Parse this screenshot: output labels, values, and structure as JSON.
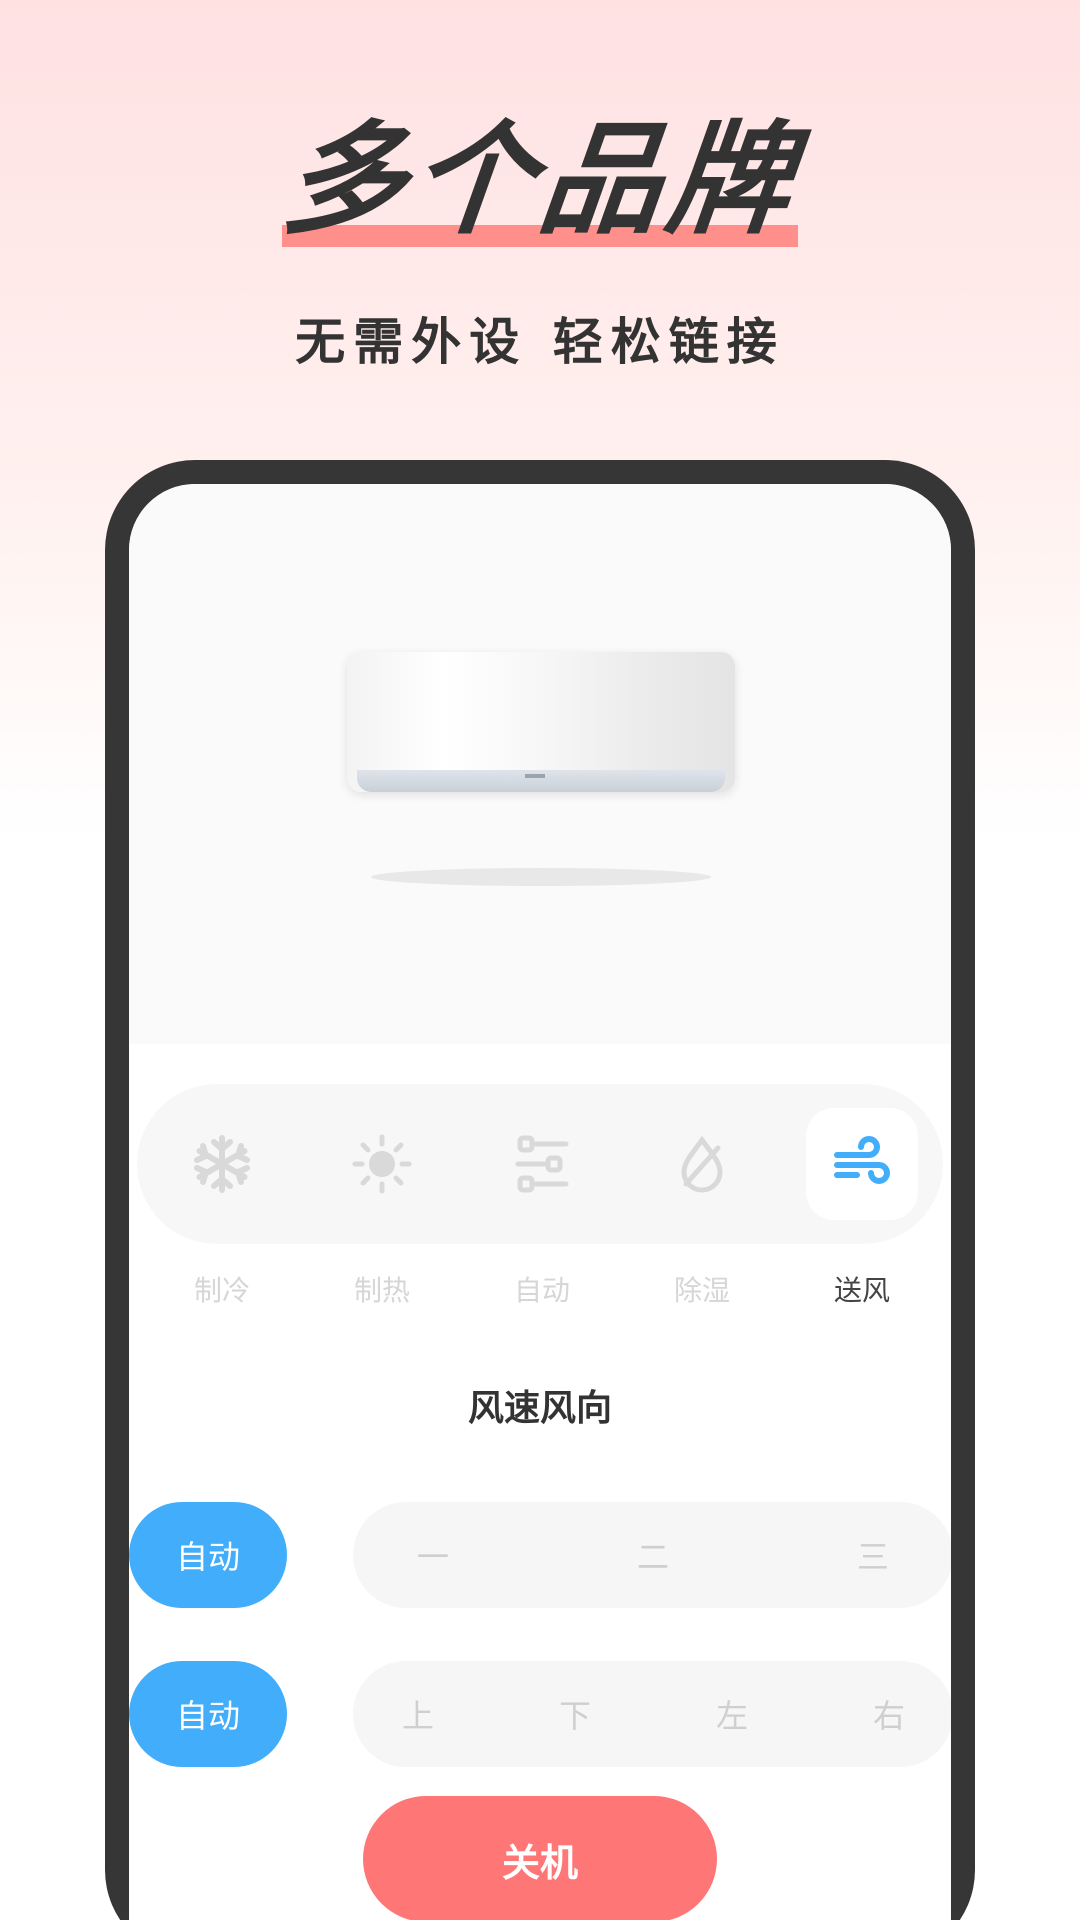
{
  "header": {
    "title": "多个品牌",
    "subtitle": "无需外设 轻松链接"
  },
  "modes": [
    {
      "label": "制冷",
      "icon": "snowflake-icon",
      "active": false
    },
    {
      "label": "制热",
      "icon": "sun-icon",
      "active": false
    },
    {
      "label": "自动",
      "icon": "sliders-icon",
      "active": false
    },
    {
      "label": "除湿",
      "icon": "droplet-slash-icon",
      "active": false
    },
    {
      "label": "送风",
      "icon": "wind-icon",
      "active": true
    }
  ],
  "fan": {
    "section_title": "风速风向",
    "speed_auto_label": "自动",
    "speed_options": [
      "一",
      "二",
      "三"
    ],
    "direction_auto_label": "自动",
    "direction_options": [
      "上",
      "下",
      "左",
      "右"
    ]
  },
  "power": {
    "off_label": "关机"
  },
  "colors": {
    "accent_blue": "#42adfb",
    "power_red": "#ff7676",
    "underline_pink": "#ff8f8b",
    "phone_frame": "#363636"
  }
}
